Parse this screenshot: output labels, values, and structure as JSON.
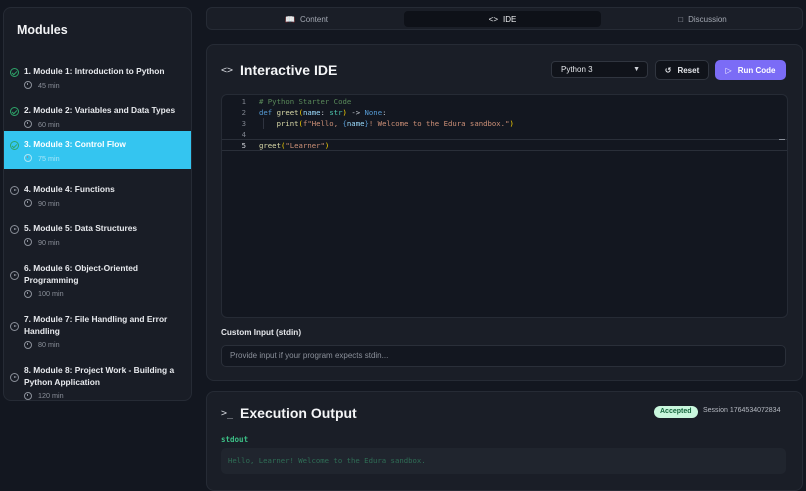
{
  "sidebar": {
    "title": "Modules",
    "modules": [
      {
        "title": "1. Module 1: Introduction to Python",
        "duration": "45 min",
        "status": "done"
      },
      {
        "title": "2. Module 2: Variables and Data Types",
        "duration": "60 min",
        "status": "done"
      },
      {
        "title": "3. Module 3: Control Flow",
        "duration": "75 min",
        "status": "active"
      },
      {
        "title": "4. Module 4: Functions",
        "duration": "90 min",
        "status": "todo"
      },
      {
        "title": "5. Module 5: Data Structures",
        "duration": "90 min",
        "status": "todo"
      },
      {
        "title_line1": "6. Module 6: Object-Oriented",
        "title_line2": "Programming",
        "duration": "100 min",
        "status": "todo"
      },
      {
        "title_line1": "7. Module 7: File Handling and Error",
        "title_line2": "Handling",
        "duration": "80 min",
        "status": "todo"
      },
      {
        "title_line1": "8. Module 8: Project Work - Building a",
        "title_line2": "Python Application",
        "duration": "120 min",
        "status": "todo"
      }
    ]
  },
  "tabs": [
    {
      "label": "Content",
      "icon": "book-icon"
    },
    {
      "label": "IDE",
      "icon": "code-icon",
      "active": true
    },
    {
      "label": "Discussion",
      "icon": "chat-icon"
    }
  ],
  "ide": {
    "title": "Interactive IDE",
    "language": "Python 3",
    "reset_label": "Reset",
    "run_label": "Run Code",
    "code_lines": [
      "1",
      "2",
      "3",
      "4",
      "5"
    ],
    "code": {
      "l1": "# Python Starter Code",
      "l2_kw": "def",
      "l2_fn": "greet",
      "l2_param": "name",
      "l2_type": "str",
      "l2_none": "None",
      "l3_fn": "print",
      "l3_str1": "f\"Hello, ",
      "l3_var": "name",
      "l3_str2": "! Welcome to the Edura sandbox.\"",
      "l5_fn": "greet",
      "l5_str": "\"Learner\""
    },
    "stdin_label": "Custom Input (stdin)",
    "stdin_placeholder": "Provide input if your program expects stdin..."
  },
  "output": {
    "title": "Execution Output",
    "status": "Accepted",
    "session": "Session 1764534072834",
    "stdout_label": "stdout",
    "stdout_text": "Hello, Learner! Welcome to the Edura sandbox."
  },
  "colors": {
    "accent": "#7b6cf6",
    "active_module": "#34c5f0",
    "success": "#2ea56a"
  }
}
